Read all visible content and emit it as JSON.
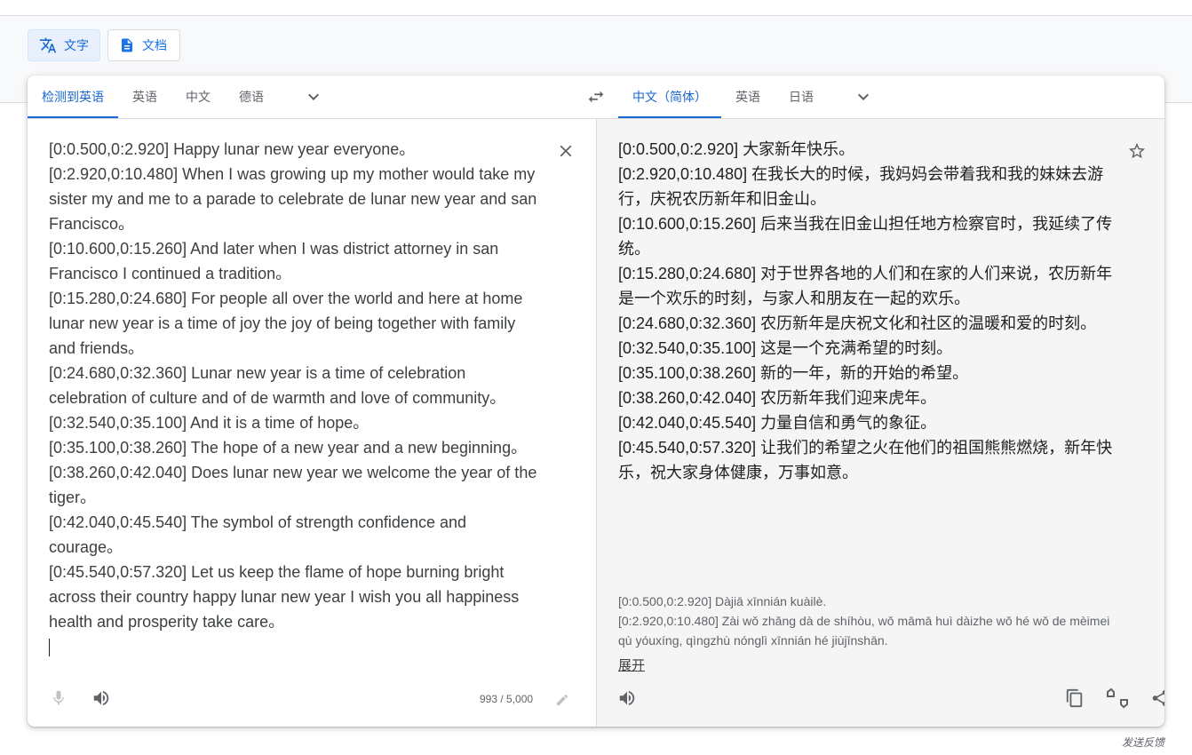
{
  "modes": {
    "text_label": "文字",
    "doc_label": "文档"
  },
  "source_langs": {
    "detected": "检测到英语",
    "items": [
      "英语",
      "中文",
      "德语"
    ]
  },
  "target_langs": {
    "selected": "中文（简体）",
    "items": [
      "英语",
      "日语"
    ]
  },
  "source": {
    "lines": [
      "[0:0.500,0:2.920]  Happy lunar new year everyone。",
      "[0:2.920,0:10.480]  When I was growing up my mother would take my",
      "sister my and me to a parade to celebrate de lunar new year and san",
      "Francisco。",
      "[0:10.600,0:15.260]  And later when I was district attorney in san",
      "Francisco I continued a tradition。",
      "[0:15.280,0:24.680]  For people all over the world and here at home",
      "lunar new year is a time of joy the joy of being together with family",
      "and friends。",
      "[0:24.680,0:32.360]  Lunar new year is a time of celebration",
      "celebration of culture and of de warmth and love of community。",
      "[0:32.540,0:35.100]  And it is a time of hope。",
      "[0:35.100,0:38.260]  The hope of a new year and a new beginning。",
      "[0:38.260,0:42.040]  Does lunar new year we welcome the year of the",
      "tiger。",
      "[0:42.040,0:45.540]  The symbol of strength confidence and",
      "courage。",
      "[0:45.540,0:57.320]  Let us keep the flame of hope burning bright",
      "across their country happy lunar new year I wish you all happiness",
      "health and prosperity take care。"
    ],
    "char_count": "993 / 5,000"
  },
  "target": {
    "lines": [
      "[0:0.500,0:2.920] 大家新年快乐。",
      "[0:2.920,0:10.480] 在我长大的时候，我妈妈会带着我和我的妹妹去游",
      "行，庆祝农历新年和旧金山。",
      "[0:10.600,0:15.260] 后来当我在旧金山担任地方检察官时，我延续了传",
      "统。",
      "[0:15.280,0:24.680] 对于世界各地的人们和在家的人们来说，农历新年",
      "是一个欢乐的时刻，与家人和朋友在一起的欢乐。",
      "[0:24.680,0:32.360] 农历新年是庆祝文化和社区的温暖和爱的时刻。",
      "[0:32.540,0:35.100] 这是一个充满希望的时刻。",
      "[0:35.100,0:38.260] 新的一年，新的开始的希望。",
      "[0:38.260,0:42.040] 农历新年我们迎来虎年。",
      "[0:42.040,0:45.540] 力量自信和勇气的象征。",
      "[0:45.540,0:57.320] 让我们的希望之火在他们的祖国熊熊燃烧，新年快",
      "乐，祝大家身体健康，万事如意。"
    ],
    "pinyin_lines": [
      "[0:0.500,0:2.920] Dàjiā xīnnián kuàilè.",
      "[0:2.920,0:10.480] Zài wǒ zhǎng dà de shíhòu, wǒ māmā huì dàizhe wǒ hé wǒ de mèimei",
      "qù yóuxíng, qìngzhù nónglì xīnnián hé jiùjīnshān."
    ],
    "expand_label": "展开"
  },
  "feedback_label": "发送反馈",
  "icons": [
    "translate-icon",
    "document-icon",
    "chevron-down-icon",
    "swap-icon",
    "close-icon",
    "star-icon",
    "mic-icon",
    "speaker-icon",
    "pencil-icon",
    "copy-icon",
    "rate-icon",
    "share-icon"
  ],
  "colors": {
    "accent": "#1967d2",
    "target_bg": "#f5f5f5",
    "band_bg": "#f8f9fa"
  }
}
